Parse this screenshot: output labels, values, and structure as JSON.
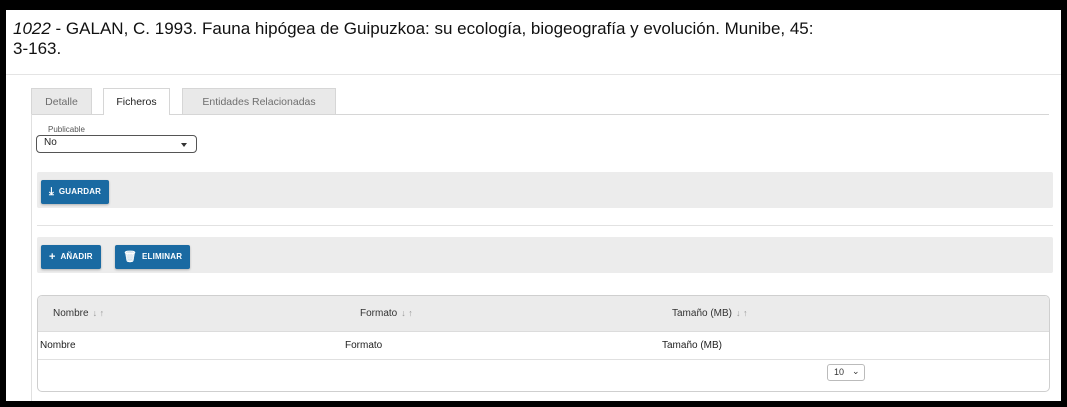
{
  "record": {
    "number": "1022",
    "citation_line1": " - GALAN, C. 1993. Fauna hipógea de Guipuzkoa: su ecología, biogeografía y evolución. Munibe, 45:",
    "citation_line2": "3-163."
  },
  "tabs": [
    {
      "label": "Detalle",
      "active": false
    },
    {
      "label": "Ficheros",
      "active": true
    },
    {
      "label": "Entidades Relacionadas",
      "active": false
    }
  ],
  "publicable": {
    "label": "Publicable",
    "value": "No"
  },
  "toolbar": {
    "save_label": "GUARDAR",
    "add_label": "AÑADIR",
    "delete_label": "ELIMINAR"
  },
  "table": {
    "columns": [
      "Nombre",
      "Formato",
      "Tamaño (MB)"
    ],
    "sort_glyph": "↓ ↑",
    "rows": [
      [
        "Nombre",
        "Formato",
        "Tamaño (MB)"
      ]
    ],
    "page_size": "10"
  },
  "colors": {
    "primary_button": "#1a6aa2",
    "toolbar_bg": "#ececec"
  }
}
